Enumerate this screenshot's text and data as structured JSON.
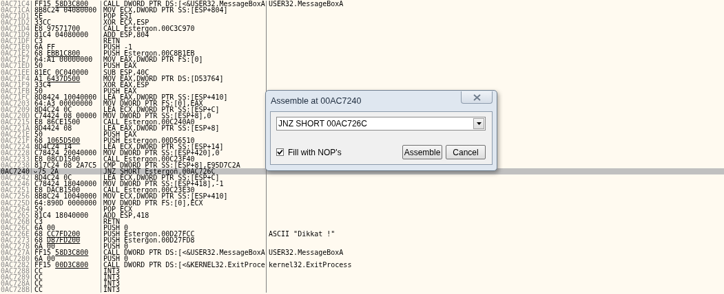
{
  "rows": [
    {
      "address": "0AC71C4",
      "hex": "FF15 ",
      "link": "58D3C800",
      "disasm": "CALL DWORD PTR DS:[<&USER32.MessageBoxA",
      "comment": "USER32.MessageBoxA",
      "selected": false
    },
    {
      "address": "0AC71CA",
      "hex": "8B8C24 04080000",
      "disasm": "MOV ECX,DWORD PTR SS:[ESP+804]",
      "selected": false
    },
    {
      "address": "0AC71D1",
      "hex": "5E",
      "disasm": "POP ESI",
      "selected": false
    },
    {
      "address": "0AC71D2",
      "hex": "33CC",
      "disasm": "XOR ECX,ESP",
      "selected": false
    },
    {
      "address": "0AC71D4",
      "hex": "E8 97571700",
      "disasm": "CALL Estergon.00C3C970",
      "selected": false
    },
    {
      "address": "0AC71D9",
      "hex": "81C4 04080000",
      "disasm": "ADD ESP,804",
      "selected": false
    },
    {
      "address": "0AC71DF",
      "hex": "C3",
      "disasm": "RETN",
      "selected": false
    },
    {
      "address": "0AC71E0",
      "hex": "6A FF",
      "disasm": "PUSH -1",
      "selected": false
    },
    {
      "address": "0AC71E2",
      "hex": "68 ",
      "link": "EBB1C800",
      "disasm": "PUSH Estergon.00C8B1EB",
      "selected": false
    },
    {
      "address": "0AC71E7",
      "hex": "64:A1 00000000",
      "disasm": "MOV EAX,DWORD PTR FS:[0]",
      "selected": false
    },
    {
      "address": "0AC71ED",
      "hex": "50",
      "disasm": "PUSH EAX",
      "selected": false
    },
    {
      "address": "0AC71EE",
      "hex": "81EC 0C040000",
      "disasm": "SUB ESP,40C",
      "selected": false
    },
    {
      "address": "0AC71F4",
      "hex": "A1 ",
      "link": "6437D500",
      "disasm": "MOV EAX,DWORD PTR DS:[D53764]",
      "selected": false
    },
    {
      "address": "0AC71F9",
      "hex": "33C4",
      "disasm": "XOR EAX,ESP",
      "selected": false
    },
    {
      "address": "0AC71FB",
      "hex": "50",
      "disasm": "PUSH EAX",
      "selected": false
    },
    {
      "address": "0AC71FC",
      "hex": "8D8424 10040000",
      "disasm": "LEA EAX,DWORD PTR SS:[ESP+410]",
      "selected": false
    },
    {
      "address": "0AC7203",
      "hex": "64:A3 00000000",
      "disasm": "MOV DWORD PTR FS:[0],EAX",
      "selected": false
    },
    {
      "address": "0AC7209",
      "hex": "8D4C24 0C",
      "disasm": "LEA ECX,DWORD PTR SS:[ESP+C]",
      "selected": false
    },
    {
      "address": "0AC720D",
      "hex": "C74424 08 00000",
      "disasm": "MOV DWORD PTR SS:[ESP+8],0",
      "selected": false
    },
    {
      "address": "0AC7215",
      "hex": "E8 86CE1500",
      "disasm": "CALL Estergon.00C240A0",
      "selected": false
    },
    {
      "address": "0AC721A",
      "hex": "8D4424 08",
      "disasm": "LEA EAX,DWORD PTR SS:[ESP+8]",
      "selected": false
    },
    {
      "address": "0AC721E",
      "hex": "50",
      "disasm": "PUSH EAX",
      "selected": false
    },
    {
      "address": "0AC721F",
      "hex": "68 ",
      "link": "1065D500",
      "disasm": "PUSH Estergon.00D56510",
      "selected": false
    },
    {
      "address": "0AC7224",
      "hex": "8D4C24 14",
      "disasm": "LEA ECX,DWORD PTR SS:[ESP+14]",
      "selected": false
    },
    {
      "address": "0AC7228",
      "hex": "C78424 20040000",
      "disasm": "MOV DWORD PTR SS:[ESP+420],0",
      "selected": false
    },
    {
      "address": "0AC7233",
      "hex": "E8 08CD1500",
      "disasm": "CALL Estergon.00C23F40",
      "selected": false
    },
    {
      "address": "0AC7238",
      "hex": "817C24 08 2A7C5",
      "disasm": "CMP DWORD PTR SS:[ESP+8],E95D7C2A",
      "selected": false
    },
    {
      "address": "0AC7240",
      "hex": "75 2A",
      "jump": true,
      "disasm": "JNZ SHORT Estergon.00AC726C",
      "selected": true
    },
    {
      "address": "0AC7242",
      "hex": "8D4C24 0C",
      "disasm": "LEA ECX,DWORD PTR SS:[ESP+C]",
      "selected": false
    },
    {
      "address": "0AC7246",
      "hex": "C78424 18040000",
      "disasm": "MOV DWORD PTR SS:[ESP+418],-1",
      "selected": false
    },
    {
      "address": "0AC7251",
      "hex": "E8 DACB1500",
      "disasm": "CALL Estergon.00C23E30",
      "selected": false
    },
    {
      "address": "0AC7256",
      "hex": "8B8C24 10040000",
      "disasm": "MOV ECX,DWORD PTR SS:[ESP+410]",
      "selected": false
    },
    {
      "address": "0AC725D",
      "hex": "64:890D 0000000",
      "disasm": "MOV DWORD PTR FS:[0],ECX",
      "selected": false
    },
    {
      "address": "0AC7264",
      "hex": "59",
      "disasm": "POP ECX",
      "selected": false
    },
    {
      "address": "0AC7265",
      "hex": "81C4 18040000",
      "disasm": "ADD ESP,418",
      "selected": false
    },
    {
      "address": "0AC726B",
      "hex": "C3",
      "disasm": "RETN",
      "selected": false
    },
    {
      "address": "0AC726C",
      "hex": "6A 00",
      "disasm": "PUSH 0",
      "selected": false
    },
    {
      "address": "0AC726E",
      "hex": "68 ",
      "link": "CC7FD200",
      "disasm": "PUSH Estergon.00D27FCC",
      "comment": "ASCII \"Dikkat !\"",
      "selected": false
    },
    {
      "address": "0AC7273",
      "hex": "68 ",
      "link": "D87FD200",
      "disasm": "PUSH Estergon.00D27FD8",
      "selected": false
    },
    {
      "address": "0AC7278",
      "hex": "6A 00",
      "disasm": "PUSH 0",
      "selected": false
    },
    {
      "address": "0AC727A",
      "hex": "FF15 ",
      "link": "58D3C800",
      "disasm": "CALL DWORD PTR DS:[<&USER32.MessageBoxA",
      "comment": "USER32.MessageBoxA",
      "selected": false
    },
    {
      "address": "0AC7280",
      "hex": "6A 00",
      "disasm": "PUSH 0",
      "selected": false
    },
    {
      "address": "0AC7282",
      "hex": "FF15 ",
      "link": "00D3C800",
      "disasm": "CALL DWORD PTR DS:[<&KERNEL32.ExitProce",
      "comment": "kernel32.ExitProcess",
      "selected": false
    },
    {
      "address": "0AC7288",
      "hex": "CC",
      "disasm": "INT3",
      "selected": false
    },
    {
      "address": "0AC7289",
      "hex": "CC",
      "disasm": "INT3",
      "selected": false
    },
    {
      "address": "0AC728A",
      "hex": "CC",
      "disasm": "INT3",
      "selected": false
    },
    {
      "address": "0AC728B",
      "hex": "CC",
      "disasm": "INT3",
      "selected": false
    }
  ],
  "dialog": {
    "title": "Assemble at 00AC7240",
    "command": "JNZ SHORT 00AC726C",
    "fill_nops": {
      "label": "Fill with NOP's",
      "checked": true
    },
    "buttons": [
      "Assemble",
      "Cancel"
    ]
  }
}
